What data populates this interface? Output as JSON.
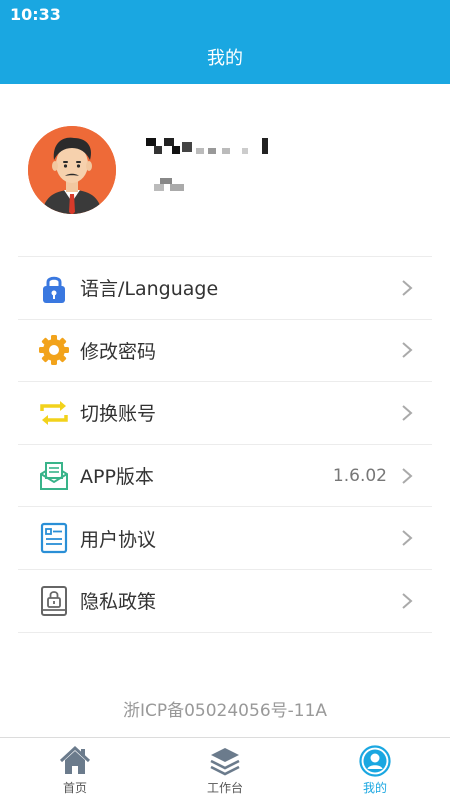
{
  "status_bar": {
    "time": "10:33"
  },
  "header": {
    "title": "我的"
  },
  "menu": {
    "items": [
      {
        "label": "语言/Language",
        "icon": "lock-icon",
        "value": ""
      },
      {
        "label": "修改密码",
        "icon": "gear-icon",
        "value": ""
      },
      {
        "label": "切换账号",
        "icon": "switch-account-icon",
        "value": ""
      },
      {
        "label": "APP版本",
        "icon": "mail-icon",
        "value": "1.6.02"
      },
      {
        "label": "用户协议",
        "icon": "document-icon",
        "value": ""
      },
      {
        "label": "隐私政策",
        "icon": "privacy-lock-icon",
        "value": ""
      }
    ]
  },
  "footer": {
    "icp": "浙ICP备05024056号-11A"
  },
  "tabbar": {
    "tabs": [
      {
        "label": "首页",
        "icon": "home-icon"
      },
      {
        "label": "工作台",
        "icon": "layers-icon"
      },
      {
        "label": "我的",
        "icon": "user-icon"
      }
    ],
    "active": "我的"
  },
  "colors": {
    "primary": "#1aa7e1",
    "avatar_bg": "#ee6a38",
    "text": "#333333",
    "muted": "#999999"
  }
}
